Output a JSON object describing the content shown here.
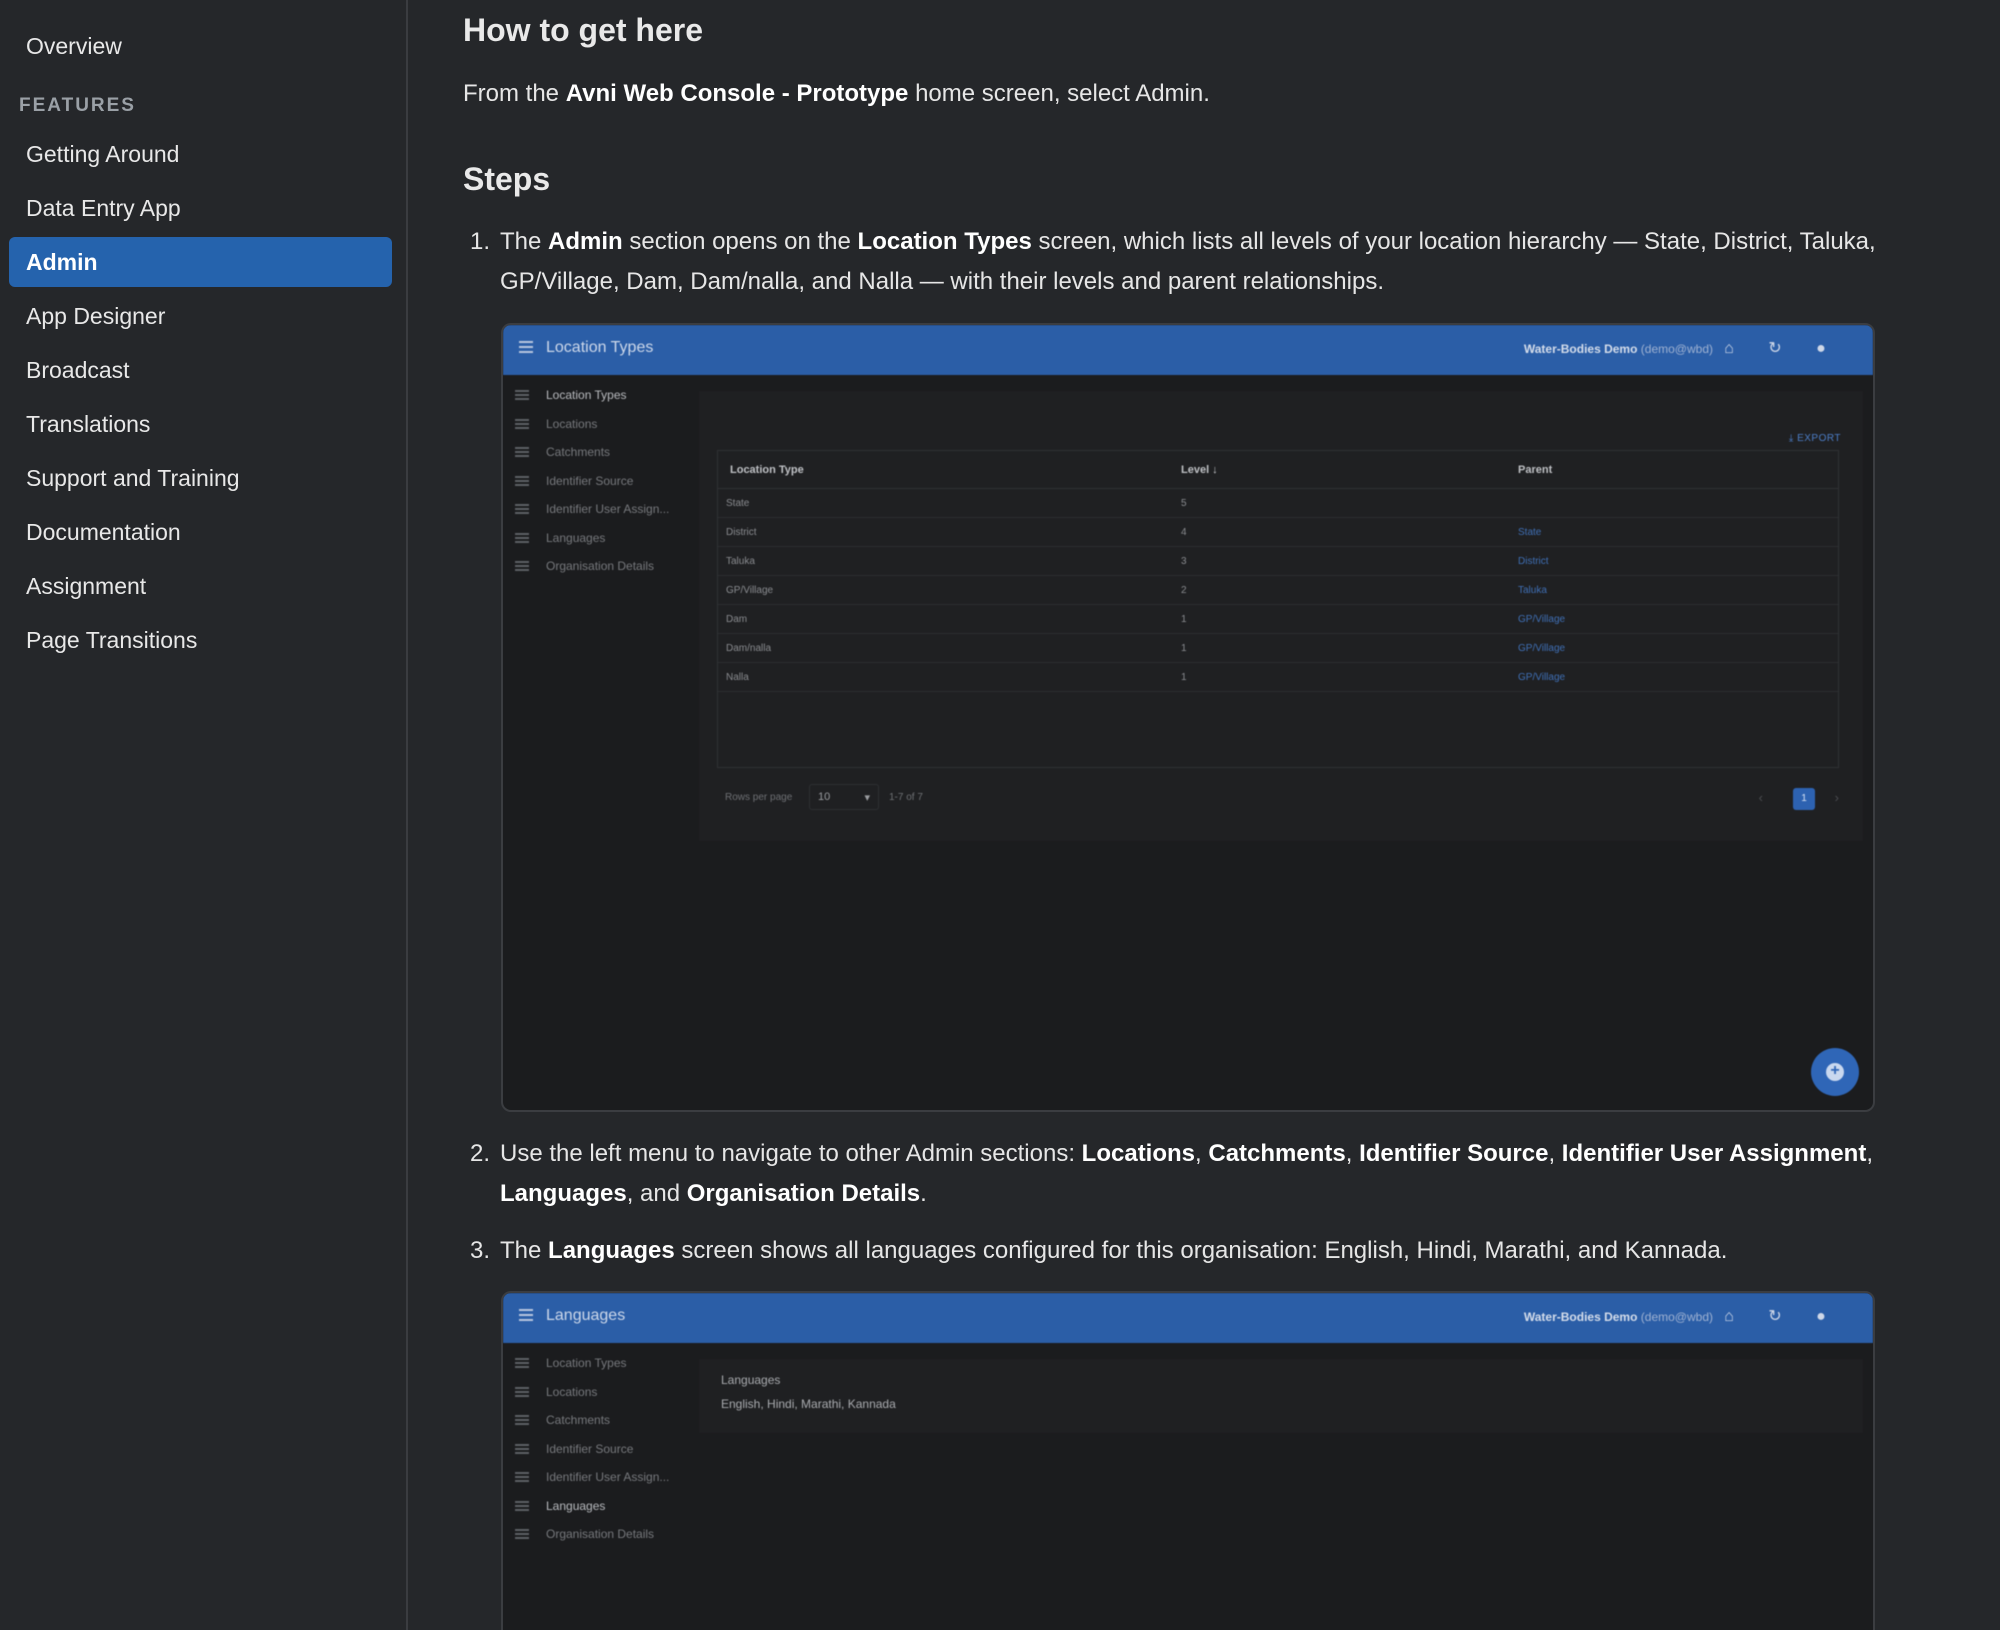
{
  "sidebar": {
    "items_top": [
      {
        "label": "Overview"
      }
    ],
    "section_label": "FEATURES",
    "items": [
      {
        "label": "Getting Around"
      },
      {
        "label": "Data Entry App"
      },
      {
        "label": "Admin",
        "active": true
      },
      {
        "label": "App Designer"
      },
      {
        "label": "Broadcast"
      },
      {
        "label": "Translations"
      },
      {
        "label": "Support and Training"
      },
      {
        "label": "Documentation"
      },
      {
        "label": "Assignment"
      },
      {
        "label": "Page Transitions"
      }
    ],
    "accent_color": "#2563ad"
  },
  "content": {
    "how_heading": "How to get here",
    "how_text": {
      "pre": "From the ",
      "bold": "Avni Web Console - Prototype",
      "post": " home screen, select Admin."
    },
    "steps_heading": "Steps",
    "steps": [
      {
        "num": "1.",
        "parts": [
          "The ",
          "Admin",
          " section opens on the ",
          "Location Types",
          " screen, which lists all levels of your location hierarchy — State, District, Taluka, GP/Village, Dam, Dam/nalla, and Nalla — with their levels and parent relationships."
        ]
      },
      {
        "num": "2.",
        "parts": [
          "Use the left menu to navigate to other Admin sections: ",
          "Locations",
          ", ",
          "Catchments",
          ", ",
          "Identifier Source",
          ", ",
          "Identifier User Assignment",
          ", ",
          "Languages",
          ", and ",
          "Organisation Details",
          "."
        ]
      },
      {
        "num": "3.",
        "parts": [
          "The ",
          "Languages",
          " screen shows all languages configured for this organisation: English, Hindi, Marathi, and Kannada."
        ]
      }
    ]
  },
  "screenshot1": {
    "title": "Location Types",
    "org_name": "Water-Bodies Demo",
    "org_user": "(demo@wbd)",
    "menu": [
      "Location Types",
      "Locations",
      "Catchments",
      "Identifier Source",
      "Identifier User Assign...",
      "Languages",
      "Organisation Details"
    ],
    "active_menu": 0,
    "export_label": "EXPORT",
    "columns": [
      "Location Type",
      "Level ↓",
      "Parent"
    ],
    "rows": [
      {
        "type": "State",
        "level": "5",
        "parent": ""
      },
      {
        "type": "District",
        "level": "4",
        "parent": "State"
      },
      {
        "type": "Taluka",
        "level": "3",
        "parent": "District"
      },
      {
        "type": "GP/Village",
        "level": "2",
        "parent": "Taluka"
      },
      {
        "type": "Dam",
        "level": "1",
        "parent": "GP/Village"
      },
      {
        "type": "Dam/nalla",
        "level": "1",
        "parent": "GP/Village"
      },
      {
        "type": "Nalla",
        "level": "1",
        "parent": "GP/Village"
      }
    ],
    "rows_per_page_label": "Rows per page",
    "rows_per_page": "10",
    "range": "1-7 of 7",
    "page": "1"
  },
  "screenshot2": {
    "title": "Languages",
    "org_name": "Water-Bodies Demo",
    "org_user": "(demo@wbd)",
    "menu": [
      "Location Types",
      "Locations",
      "Catchments",
      "Identifier Source",
      "Identifier User Assign...",
      "Languages",
      "Organisation Details"
    ],
    "active_menu": 5,
    "heading": "Languages",
    "value": "English, Hindi, Marathi, Kannada"
  }
}
